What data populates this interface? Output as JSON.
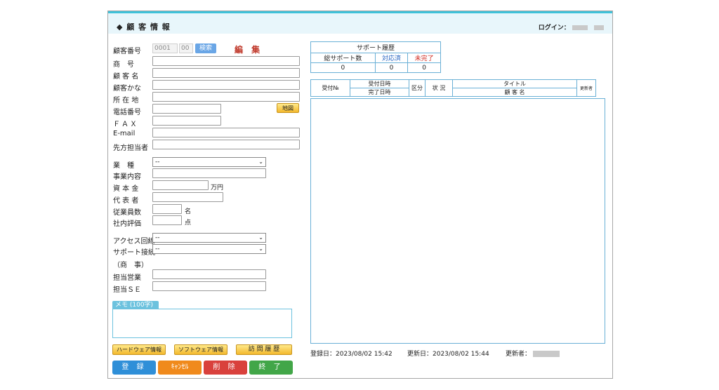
{
  "header": {
    "title": "◆ 顧 客 情 報",
    "login_label": "ログイン："
  },
  "form": {
    "customer_no_label": "顧客番号",
    "customer_no_value": "0001",
    "customer_no_sub": "00",
    "search_button": "検索",
    "mode": "編 集",
    "shop_name_label": "商　号",
    "customer_name_label": "顧 客 名",
    "customer_kana_label": "顧客かな",
    "address_label": "所 在 地",
    "phone_label": "電話番号",
    "map_button": "地図",
    "fax_label": "ＦＡＸ",
    "email_label": "E-mail",
    "contact_label": "先方担当者",
    "industry_label": "業　種",
    "industry_value": "--",
    "business_label": "事業内容",
    "capital_label": "資 本 金",
    "capital_unit": "万円",
    "representative_label": "代 表 者",
    "employees_label": "従業員数",
    "employees_unit": "名",
    "rating_label": "社内評価",
    "rating_unit": "点",
    "access_label": "アクセス回線",
    "access_value": "--",
    "support_conn_label": "サポート接続",
    "support_conn_value": "--",
    "commerce_label": "（商　事）",
    "sales_label": "担当営業",
    "se_label": "担当ＳＥ",
    "memo_label": "メモ (100字)"
  },
  "buttons": {
    "hardware": "ハードウェア情報",
    "software": "ソフトウェア情報",
    "visit_history": "訪 問 履 歴",
    "register": "登 録",
    "cancel": "ｷｬﾝｾﾙ",
    "delete": "削 除",
    "close": "終 了"
  },
  "support": {
    "title": "サポート履歴",
    "headers": [
      "総サポート数",
      "対応済",
      "未完了"
    ],
    "values": [
      "0",
      "0",
      "0"
    ]
  },
  "list_headers": {
    "receipt_no": "受付№",
    "receipt_date": "受付日時",
    "complete_date": "完了日時",
    "category": "区分",
    "status": "状 況",
    "title": "タイトル",
    "customer": "顧 客 名",
    "updater": "更新者"
  },
  "footer": {
    "registered": "登録日：2023/08/02 15:42",
    "updated": "更新日：2023/08/02 15:44",
    "updater_label": "更新者："
  },
  "colors": {
    "accent": "#3fc2d9",
    "register": "#2f8fd8",
    "cancel": "#f08a1c",
    "delete": "#d9413c",
    "close": "#42a648"
  }
}
